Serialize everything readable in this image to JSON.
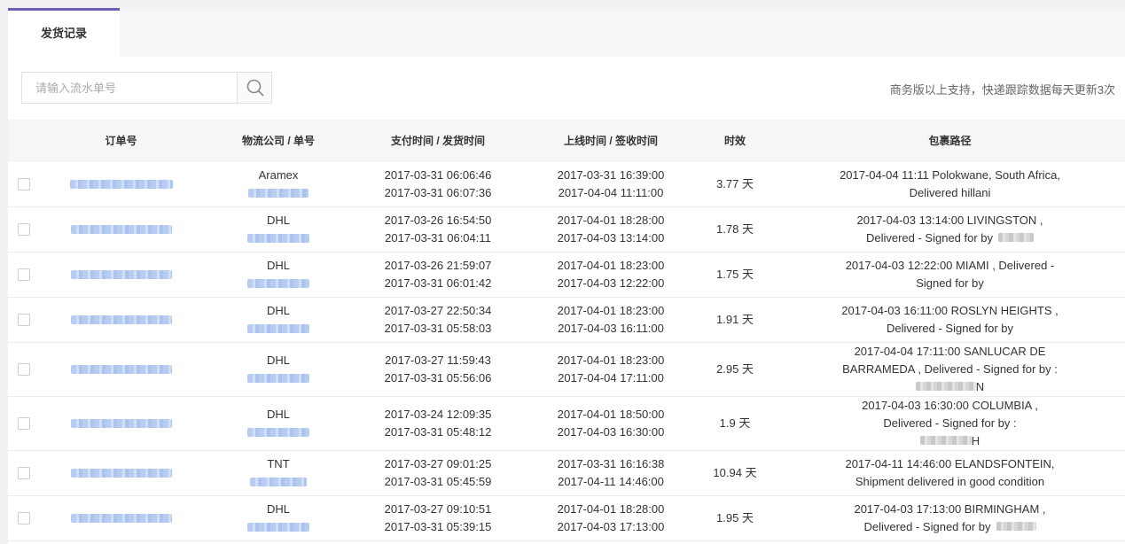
{
  "tabs": [
    {
      "label": "发货记录",
      "active": true
    }
  ],
  "search": {
    "placeholder": "请输入流水单号"
  },
  "notice": "商务版以上支持，快递跟踪数据每天更新3次",
  "columns": [
    "订单号",
    "物流公司 / 单号",
    "支付时间 / 发货时间",
    "上线时间 / 签收时间",
    "时效",
    "包裹路径"
  ],
  "colors": {
    "accent": "#6b5fb5",
    "link_blur": "#a9c3ee"
  },
  "rows": [
    {
      "carrier": "Aramex",
      "paid": "2017-03-31 06:06:46",
      "shipped": "2017-03-31 06:07:36",
      "online": "2017-03-31 16:39:00",
      "signed": "2017-04-04 11:11:00",
      "duration": "3.77 天",
      "route": [
        "2017-04-04 11:11 Polokwane, South Africa,",
        "Delivered hillani"
      ]
    },
    {
      "carrier": "DHL",
      "paid": "2017-03-26 16:54:50",
      "shipped": "2017-03-31 06:04:11",
      "online": "2017-04-01 18:28:00",
      "signed": "2017-04-03 13:14:00",
      "duration": "1.78 天",
      "route": [
        "2017-04-03 13:14:00 LIVINGSTON ,",
        "Delivered - Signed for by"
      ]
    },
    {
      "carrier": "DHL",
      "paid": "2017-03-26 21:59:07",
      "shipped": "2017-03-31 06:01:42",
      "online": "2017-04-01 18:23:00",
      "signed": "2017-04-03 12:22:00",
      "duration": "1.75 天",
      "route": [
        "2017-04-03 12:22:00 MIAMI , Delivered -",
        "Signed for by"
      ]
    },
    {
      "carrier": "DHL",
      "paid": "2017-03-27 22:50:34",
      "shipped": "2017-03-31 05:58:03",
      "online": "2017-04-01 18:23:00",
      "signed": "2017-04-03 16:11:00",
      "duration": "1.91 天",
      "route": [
        "2017-04-03 16:11:00 ROSLYN HEIGHTS ,",
        "Delivered - Signed for by"
      ]
    },
    {
      "carrier": "DHL",
      "paid": "2017-03-27 11:59:43",
      "shipped": "2017-03-31 05:56:06",
      "online": "2017-04-01 18:23:00",
      "signed": "2017-04-04 17:11:00",
      "duration": "2.95 天",
      "route": [
        "2017-04-04 17:11:00 SANLUCAR DE",
        "BARRAMEDA , Delivered - Signed for by :",
        "N"
      ]
    },
    {
      "carrier": "DHL",
      "paid": "2017-03-24 12:09:35",
      "shipped": "2017-03-31 05:48:12",
      "online": "2017-04-01 18:50:00",
      "signed": "2017-04-03 16:30:00",
      "duration": "1.9 天",
      "route": [
        "2017-04-03 16:30:00 COLUMBIA ,",
        "Delivered - Signed for by :",
        "H"
      ]
    },
    {
      "carrier": "TNT",
      "paid": "2017-03-27 09:01:25",
      "shipped": "2017-03-31 05:45:59",
      "online": "2017-03-31 16:16:38",
      "signed": "2017-04-11 14:46:00",
      "duration": "10.94 天",
      "route": [
        "2017-04-11 14:46:00 ELANDSFONTEIN,",
        "Shipment delivered in good condition"
      ]
    },
    {
      "carrier": "DHL",
      "paid": "2017-03-27 09:10:51",
      "shipped": "2017-03-31 05:39:15",
      "online": "2017-04-01 18:28:00",
      "signed": "2017-04-03 17:13:00",
      "duration": "1.95 天",
      "route": [
        "2017-04-03 17:13:00 BIRMINGHAM ,",
        "Delivered - Signed for by"
      ]
    }
  ]
}
